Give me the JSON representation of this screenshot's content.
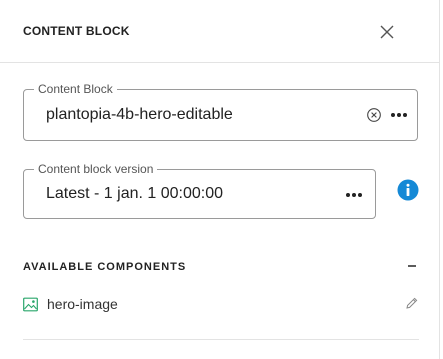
{
  "header": {
    "title": "CONTENT BLOCK",
    "close_icon": "close-icon"
  },
  "content_block_field": {
    "legend": "Content Block",
    "value": "plantopia-4b-hero-editable",
    "clear_icon": "clear-circle-icon",
    "more_icon": "more-horizontal-icon"
  },
  "version_field": {
    "legend": "Content block version",
    "value": "Latest - 1 jan. 1 00:00:00",
    "more_icon": "more-horizontal-icon",
    "info_icon": "info-icon"
  },
  "available_components": {
    "title": "AVAILABLE COMPONENTS",
    "collapse_icon": "minus-icon",
    "items": [
      {
        "label": "hero-image",
        "icon": "image-icon",
        "edit_icon": "pencil-icon"
      }
    ]
  },
  "colors": {
    "accent": "#1589d6",
    "image_icon": "#2aa66b",
    "border": "#9a9a9a",
    "divider": "#e3e3e3"
  }
}
